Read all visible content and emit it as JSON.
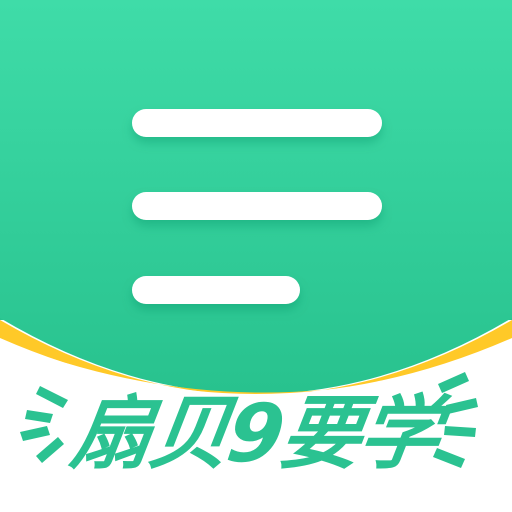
{
  "app": {
    "name": "扇贝9要学",
    "icon_name": "menu-lines-icon"
  },
  "colors": {
    "brand_green": "#3ad9a4",
    "brand_green_dark": "#29c48e",
    "text_green": "#2bc291",
    "white": "#ffffff",
    "wave_blue": "#4aa6ea",
    "wave_yellow": "#ffc928"
  }
}
